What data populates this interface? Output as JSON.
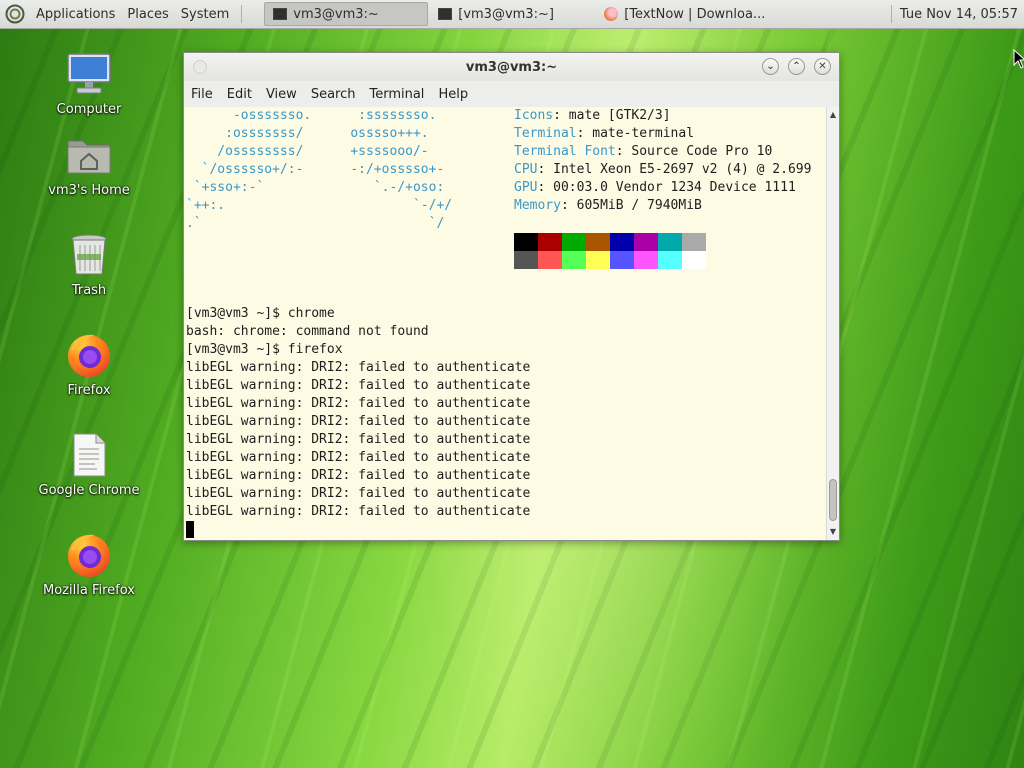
{
  "panel": {
    "menus": [
      "Applications",
      "Places",
      "System"
    ],
    "tasks": [
      {
        "label": "vm3@vm3:~",
        "active": true
      },
      {
        "label": "[vm3@vm3:~]",
        "active": false
      },
      {
        "label": "[TextNow | Downloa...",
        "active": false
      }
    ],
    "clock": "Tue Nov 14, 05:57"
  },
  "desktop": {
    "icons": [
      {
        "label": "Computer",
        "icon": "computer-icon"
      },
      {
        "label": "vm3's Home",
        "icon": "home-folder-icon"
      },
      {
        "label": "Trash",
        "icon": "trash-icon"
      },
      {
        "label": "Firefox",
        "icon": "firefox-icon"
      },
      {
        "label": "Google Chrome",
        "icon": "document-icon"
      },
      {
        "label": "Mozilla Firefox",
        "icon": "firefox-icon"
      }
    ]
  },
  "window": {
    "title": "vm3@vm3:~",
    "menu": [
      "File",
      "Edit",
      "View",
      "Search",
      "Terminal",
      "Help"
    ]
  },
  "terminal": {
    "art_lines": [
      "      -osssssso.      :ssssssso.",
      "     :osssssss/      osssso+++.",
      "    /ossssssss/      +ssssooo/-",
      "  `/ossssso+/:-      -:/+osssso+-",
      " `+sso+:-`              `.-/+oso:",
      "`++:.                        `-/+/",
      ".`                             `/"
    ],
    "info": [
      {
        "label": "Icons",
        "value": ": mate [GTK2/3]"
      },
      {
        "label": "Terminal",
        "value": ": mate-terminal"
      },
      {
        "label": "Terminal Font",
        "value": ": Source Code Pro 10"
      },
      {
        "label": "CPU",
        "value": ": Intel Xeon E5-2697 v2 (4) @ 2.699"
      },
      {
        "label": "GPU",
        "value": ": 00:03.0 Vendor 1234 Device 1111"
      },
      {
        "label": "Memory",
        "value": ": 605MiB / 7940MiB"
      }
    ],
    "palette_top": [
      "#000000",
      "#aa0000",
      "#00aa00",
      "#aa5500",
      "#0000aa",
      "#aa00aa",
      "#00aaaa",
      "#aaaaaa"
    ],
    "palette_bottom": [
      "#555555",
      "#ff5555",
      "#55ff55",
      "#ffff55",
      "#5555ff",
      "#ff55ff",
      "#55ffff",
      "#ffffff"
    ],
    "output": [
      "[vm3@vm3 ~]$ chrome",
      "bash: chrome: command not found",
      "[vm3@vm3 ~]$ firefox",
      "libEGL warning: DRI2: failed to authenticate",
      "libEGL warning: DRI2: failed to authenticate",
      "libEGL warning: DRI2: failed to authenticate",
      "libEGL warning: DRI2: failed to authenticate",
      "libEGL warning: DRI2: failed to authenticate",
      "libEGL warning: DRI2: failed to authenticate",
      "libEGL warning: DRI2: failed to authenticate",
      "libEGL warning: DRI2: failed to authenticate",
      "libEGL warning: DRI2: failed to authenticate"
    ]
  }
}
